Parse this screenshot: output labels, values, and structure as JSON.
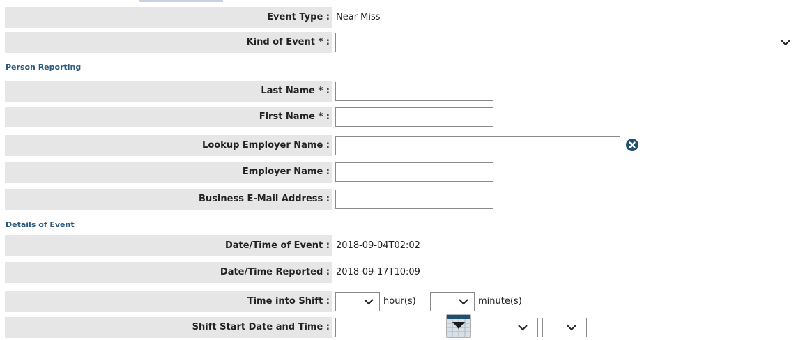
{
  "form": {
    "event_type": {
      "label": "Event Type :",
      "value": "Near Miss"
    },
    "kind_of_event": {
      "label": "Kind of Event * :",
      "value": ""
    },
    "sections": {
      "person_reporting": "Person Reporting",
      "details_of_event": "Details of Event"
    },
    "last_name": {
      "label": "Last Name * :",
      "value": ""
    },
    "first_name": {
      "label": "First Name * :",
      "value": ""
    },
    "lookup_employer": {
      "label": "Lookup Employer Name :",
      "value": "",
      "clear_icon": "clear-x-circle-icon"
    },
    "employer_name": {
      "label": "Employer Name :",
      "value": ""
    },
    "business_email": {
      "label": "Business E-Mail Address :",
      "value": ""
    },
    "datetime_event": {
      "label": "Date/Time of Event :",
      "value": "2018-09-04T02:02"
    },
    "datetime_reported": {
      "label": "Date/Time Reported :",
      "value": "2018-09-17T10:09"
    },
    "time_into_shift": {
      "label": "Time into Shift :",
      "hour_unit": "hour(s)",
      "minute_unit": "minute(s)"
    },
    "shift_start": {
      "label": "Shift Start Date and Time :",
      "date_value": "",
      "calendar_icon": "calendar-icon"
    }
  },
  "colors": {
    "label_bg": "#e6e6e6",
    "section_text": "#2a5a7f",
    "clear_icon_bg": "#1f4f6f"
  }
}
